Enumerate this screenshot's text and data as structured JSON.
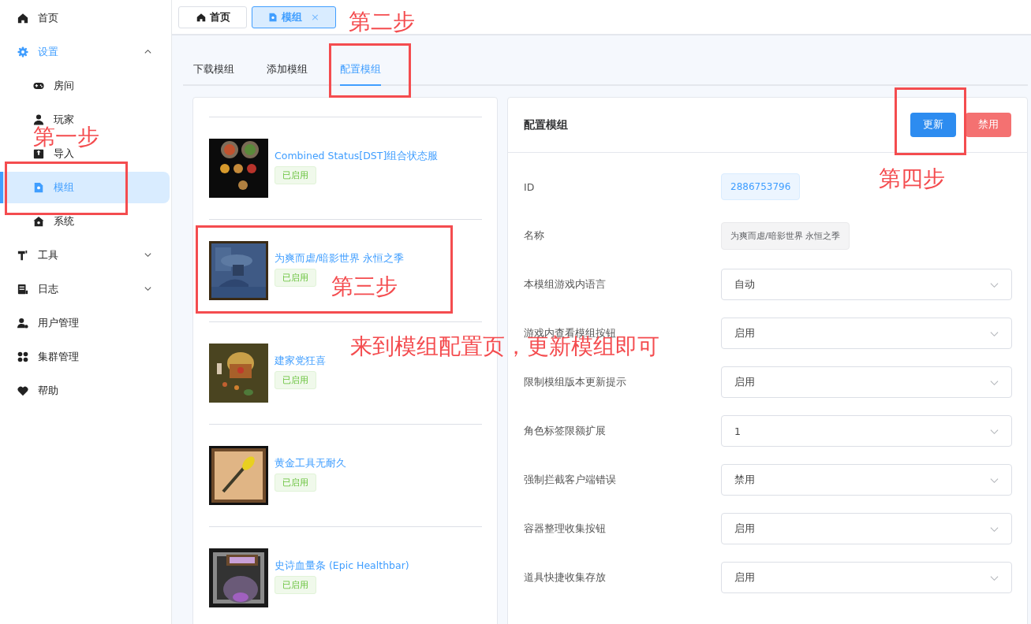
{
  "sidebar": {
    "items": [
      {
        "label": "首页",
        "selected": false
      },
      {
        "label": "设置",
        "selected": false,
        "expanded": true,
        "children": [
          {
            "label": "房间",
            "selected": false
          },
          {
            "label": "玩家",
            "selected": false
          },
          {
            "label": "导入",
            "selected": false
          },
          {
            "label": "模组",
            "selected": true
          },
          {
            "label": "系统",
            "selected": false
          }
        ]
      },
      {
        "label": "工具",
        "selected": false,
        "expanded": false
      },
      {
        "label": "日志",
        "selected": false,
        "expanded": false
      },
      {
        "label": "用户管理",
        "selected": false
      },
      {
        "label": "集群管理",
        "selected": false
      },
      {
        "label": "帮助",
        "selected": false
      }
    ]
  },
  "page_tabs": [
    {
      "label": "首页",
      "selected": false
    },
    {
      "label": "模组",
      "selected": true,
      "close": "×"
    }
  ],
  "tabs": [
    {
      "label": "下载模组",
      "selected": false
    },
    {
      "label": "添加模组",
      "selected": false
    },
    {
      "label": "配置模组",
      "selected": true
    }
  ],
  "mods": [
    {
      "name": "Combined Status[DST]组合状态服",
      "status": "已启用"
    },
    {
      "name": "为爽而虐/暗影世界 永恒之季",
      "status": "已启用"
    },
    {
      "name": "建家党狂喜",
      "status": "已启用"
    },
    {
      "name": "黄金工具无耐久",
      "status": "已启用"
    },
    {
      "name": "史诗血量条 (Epic Healthbar)",
      "status": "已启用"
    }
  ],
  "config": {
    "title": "配置模组",
    "buttons": [
      {
        "label": "更新",
        "kind": "primary"
      },
      {
        "label": "禁用",
        "kind": "danger"
      }
    ],
    "fields": [
      {
        "label": "ID",
        "value": "2886753796",
        "kind": "tag"
      },
      {
        "label": "名称",
        "value": "为爽而虐/暗影世界 永恒之季",
        "kind": "readonly"
      },
      {
        "label": "本模组游戏内语言",
        "value": "自动",
        "kind": "select"
      },
      {
        "label": "游戏内查看模组按钮",
        "value": "启用",
        "kind": "select"
      },
      {
        "label": "限制模组版本更新提示",
        "value": "启用",
        "kind": "select"
      },
      {
        "label": "角色标签限额扩展",
        "value": "1",
        "kind": "select"
      },
      {
        "label": "强制拦截客户端错误",
        "value": "禁用",
        "kind": "select"
      },
      {
        "label": "容器整理收集按钮",
        "value": "启用",
        "kind": "select"
      },
      {
        "label": "道具快捷收集存放",
        "value": "启用",
        "kind": "select"
      }
    ]
  },
  "annotations": [
    {
      "text": "第一步"
    },
    {
      "text": "第二步"
    },
    {
      "text": "第三步"
    },
    {
      "text": "第四步"
    },
    {
      "text": "来到模组配置页，更新模组即可"
    }
  ]
}
